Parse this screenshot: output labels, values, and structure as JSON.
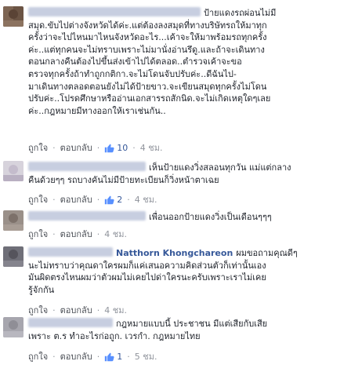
{
  "ui": {
    "like_label": "ถูกใจ",
    "reply_label": "ตอบกลับ",
    "separator": "·",
    "like_color": "#365899"
  },
  "comments": [
    {
      "author": "",
      "lines": [
        "ป้ายแดงรถผ่อนไม่มี",
        "สมุด.ขับไปต่างจังหวัดได้ค่ะ.แต่ต้องลงสมุดที่ทางบริษัทรถให้มาทุก",
        "ครั้งว่าจะไปไหนมาไหนจังหวัดอะไร...เค้าจะให้มาพร้อมรถทุกครั้ง",
        "ค่ะ..แต่ทุกคนจะไม่ทราบเพราะไม่มานั่งอ่านรึดู.และถ้าจะเดินทาง",
        "ตอนกลางคืนต้องไปขึ้นส่งเข้าไปได้ตลอด..ตำรวจเค้าจะขอ",
        "ตรวจทุกครั้งถ้าทำถูกกติกา.จะไม่โดนจับปรับค่ะ..ดีฉันไป-",
        "มาเดินทางตลอดตอนยังไม่ได้ป้ายขาว.จะเขียนสมุดทุกครั้งไม่โดน",
        "ปรับค่ะ..โปรดศึกษาหรืออ่านเอกสารรถสักนิด.จะไม่เกิดเหตุใดๆเลย",
        "ค่ะ..กฎหมายมีทางออกให้เราเช่นกัน.."
      ],
      "likes": "10",
      "time": "4 ชม."
    },
    {
      "author": "",
      "lines": [
        "เห็นป้ายแดงวิ่งสลอนทุกวัน แม่แต่กลาง",
        "คืนด้วยๆๆ รถบางคันไม่มีป้ายทะเบียนก็วิ่งหน้าตาเฉย"
      ],
      "likes": "2",
      "time": "4 ชม."
    },
    {
      "author": "",
      "lines": [
        "เพื่อนออกป้ายแดงวิ่งเป็นเดือนๆๆๆ"
      ],
      "likes": "",
      "time": "4 ชม."
    },
    {
      "author": "Natthorn Khongchareon",
      "lines": [
        "ผมขอถามคุณดีๆ",
        "นะไม่ทราบว่าคุณดาใครผมก็แค่เสนอความคิดส่วนตัวก็เท่านั้นเอง",
        "มันผิดตรงไหนผมว่าตัวผมไม่เคยไปด่าใครนะครับเพราะเราไม่เคย",
        "รู้จักกัน"
      ],
      "likes": "",
      "time": "4 ชม."
    },
    {
      "author": "",
      "lines": [
        "กฎหมายแบบนี้ ประชาชน มีแต่เสียกับเสีย",
        "เพราะ ต.ร ทำอะไรก่อถูก. เวรกำ. กฎหมายไทย"
      ],
      "likes": "1",
      "time": "5 ชม."
    }
  ]
}
